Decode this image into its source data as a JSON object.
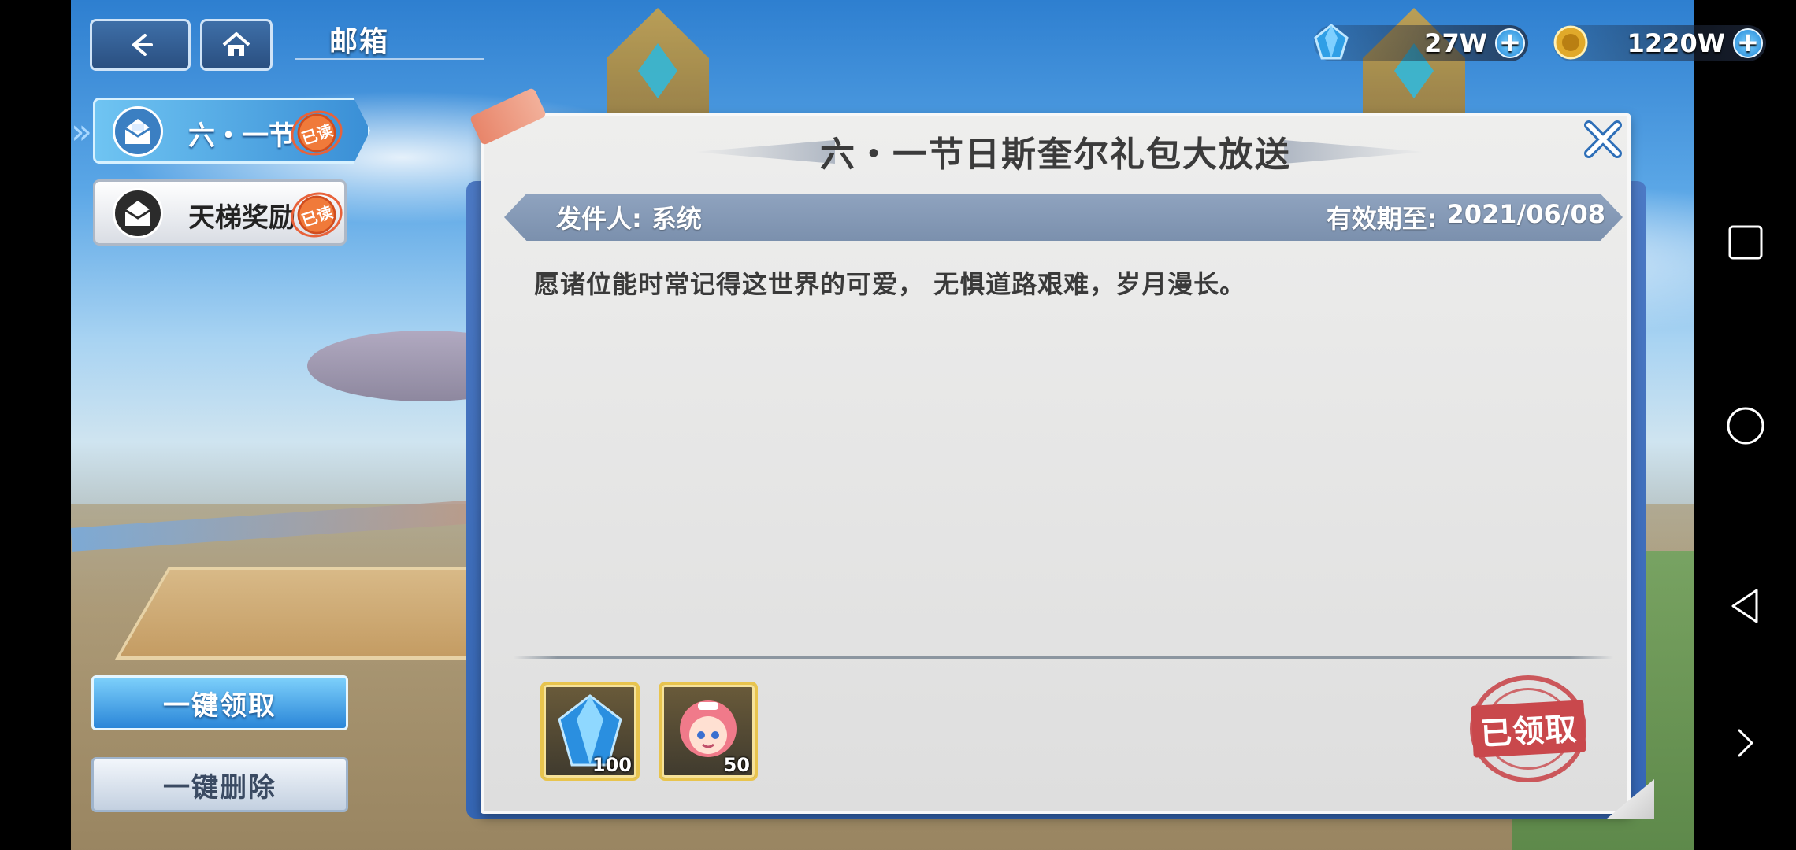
{
  "header": {
    "title": "邮箱"
  },
  "currency": {
    "gems": "27W",
    "gold": "1220W"
  },
  "mail_list": [
    {
      "title": "六・一节",
      "status": "已读",
      "selected": true
    },
    {
      "title": "天梯奖励",
      "status": "已读",
      "selected": false
    }
  ],
  "actions": {
    "claim_all": "一键领取",
    "delete_all": "一键删除"
  },
  "mail": {
    "title": "六・一节日斯奎尔礼包大放送",
    "sender_label": "发件人:",
    "sender": "系统",
    "expiry_label": "有效期至:",
    "expiry": "2021/06/08",
    "body": "愿诸位能时常记得这世界的可爱， 无惧道路艰难，岁月漫长。",
    "rewards": [
      {
        "icon": "blue-gem-icon",
        "quantity": "100"
      },
      {
        "icon": "character-portrait-icon",
        "quantity": "50"
      }
    ],
    "claimed_stamp": "已领取"
  },
  "colors": {
    "selected_item": "#3a8fd6",
    "sender_bar": "#8fa3bf",
    "stamp": "#c9484c",
    "read_badge": "#f07a3a"
  }
}
